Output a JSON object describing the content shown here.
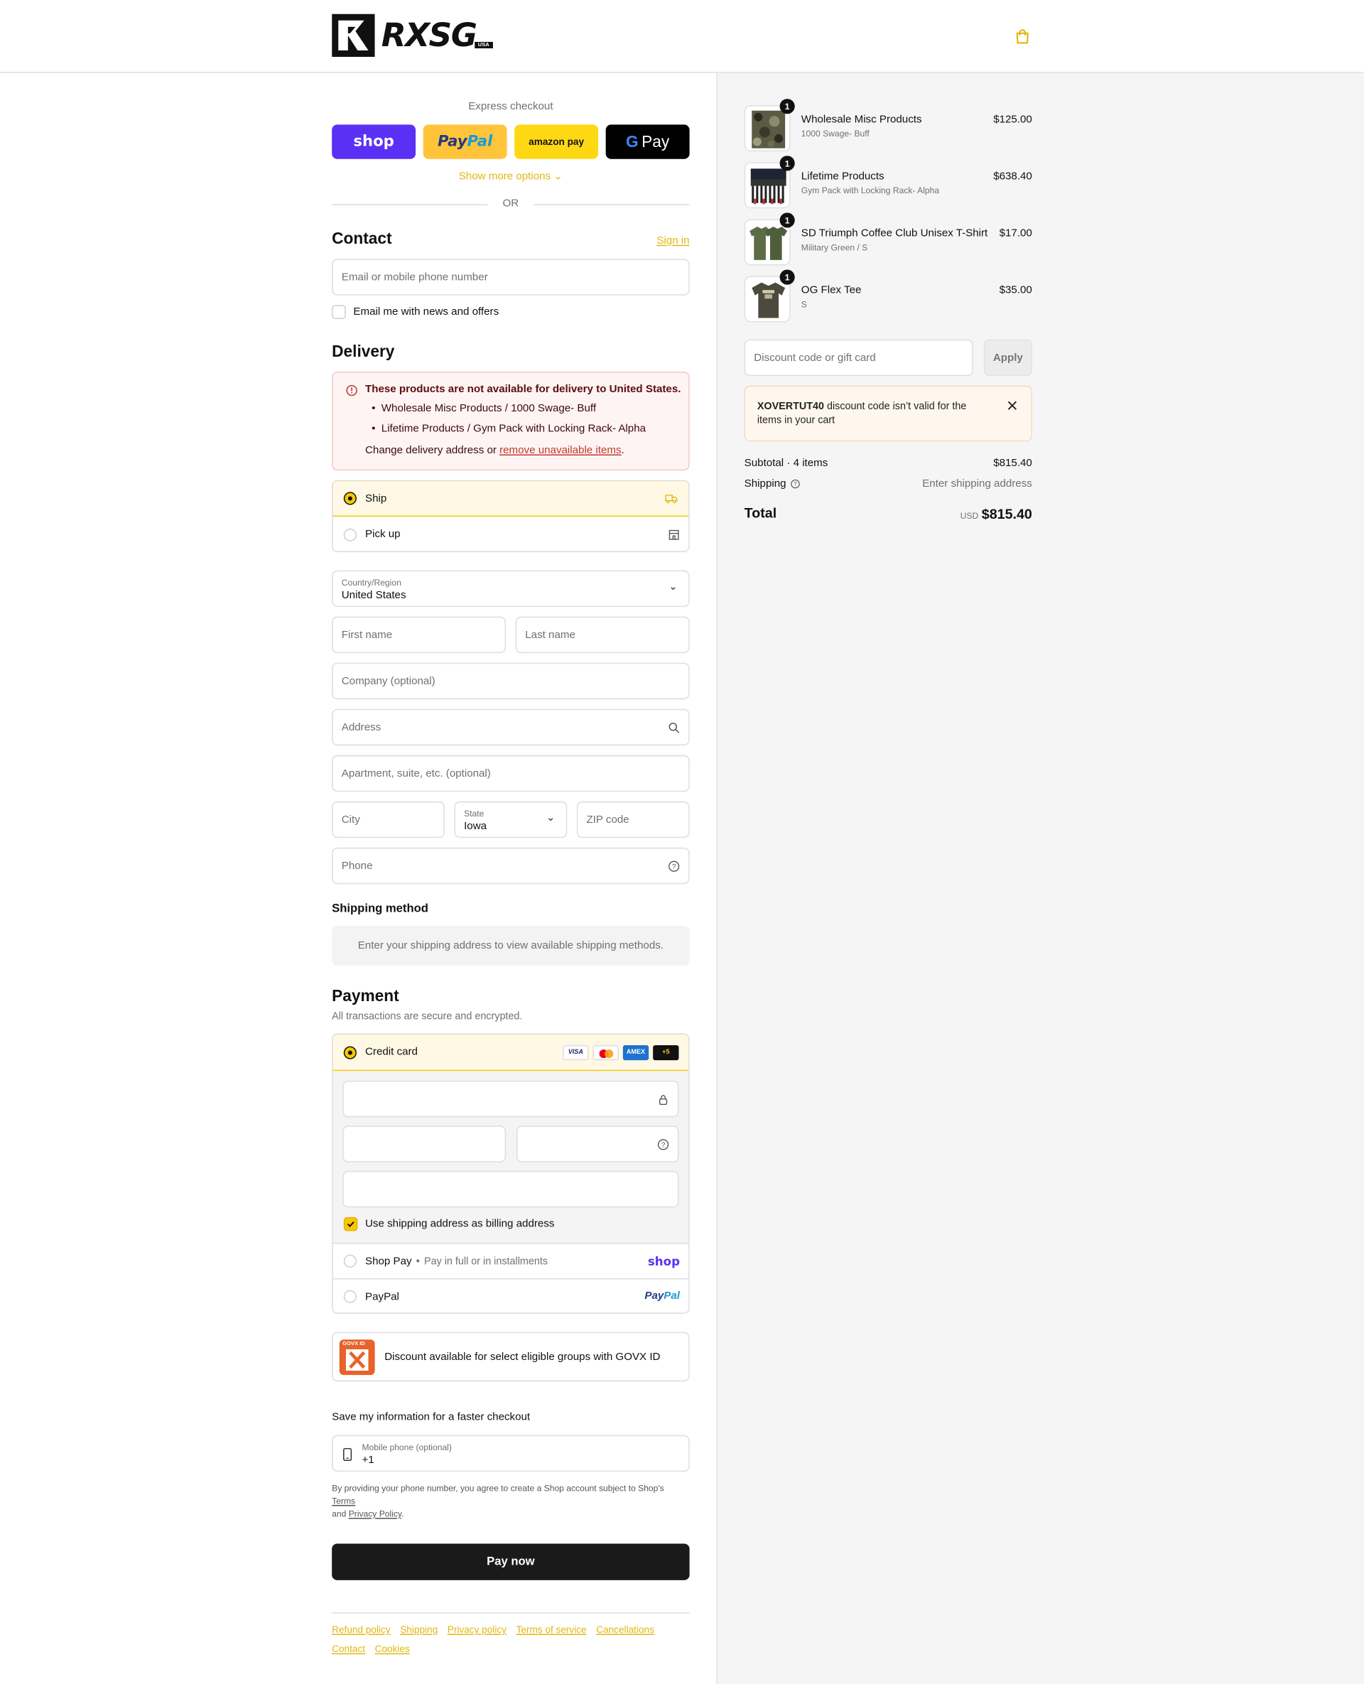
{
  "brand": {
    "name": "RXSG",
    "badge": "USA",
    "accent": "#f8c800",
    "link_color": "#e1b70e"
  },
  "express": {
    "label": "Express checkout",
    "shop_label": "shop",
    "paypal_label_1": "Pay",
    "paypal_label_2": "Pal",
    "amazon_label": "amazon pay",
    "gpay_label": "Pay",
    "show_more": "Show more options",
    "or_label": "OR"
  },
  "contact": {
    "title": "Contact",
    "sign_in": "Sign in",
    "email_placeholder": "Email or mobile phone number",
    "newsletter_label": "Email me with news and offers"
  },
  "delivery": {
    "title": "Delivery",
    "error_title": "These products are not available for delivery to United States.",
    "error_items": [
      "Wholesale Misc Products / 1000 Swage- Buff",
      "Lifetime Products / Gym Pack with Locking Rack- Alpha"
    ],
    "error_change_text": "Change delivery address or ",
    "error_remove_link": "remove unavailable items",
    "error_period": ".",
    "ship_label": "Ship",
    "pickup_label": "Pick up",
    "country_label": "Country/Region",
    "country_value": "United States",
    "first_name": "First name",
    "last_name": "Last name",
    "company": "Company (optional)",
    "address": "Address",
    "apartment": "Apartment, suite, etc. (optional)",
    "city": "City",
    "state_label": "State",
    "state_value": "Iowa",
    "zip": "ZIP code",
    "phone": "Phone"
  },
  "shipping_method": {
    "title": "Shipping method",
    "message": "Enter your shipping address to view available shipping methods."
  },
  "payment": {
    "title": "Payment",
    "subtitle": "All transactions are secure and encrypted.",
    "credit_card_label": "Credit card",
    "card_badges": [
      "VISA",
      "",
      "AMEX",
      "+5"
    ],
    "billing_same_label": "Use shipping address as billing address",
    "shop_pay_label": "Shop Pay",
    "shop_pay_sub": "Pay in full or in installments",
    "shop_pay_logo": "shop",
    "paypal_label": "PayPal",
    "paypal_logo_1": "Pay",
    "paypal_logo_2": "Pal"
  },
  "govx": {
    "logo_text": "GOVX ID",
    "text": "Discount available for select eligible groups with GOVX ID"
  },
  "save_info": {
    "title": "Save my information for a faster checkout",
    "mobile_label": "Mobile phone (optional)",
    "mobile_value": "+1",
    "legal_1": "By providing your phone number, you agree to create a Shop account subject to Shop's ",
    "legal_terms": "Terms",
    "legal_2": "and ",
    "legal_privacy": "Privacy Policy",
    "legal_3": "."
  },
  "pay_now": "Pay now",
  "footer_links": [
    "Refund policy",
    "Shipping",
    "Privacy policy",
    "Terms of service",
    "Cancellations",
    "Contact",
    "Cookies"
  ],
  "cart": {
    "items": [
      {
        "qty": "1",
        "name": "Wholesale Misc Products",
        "variant": "1000 Swage- Buff",
        "price": "$125.00"
      },
      {
        "qty": "1",
        "name": "Lifetime Products",
        "variant": "Gym Pack with Locking Rack- Alpha",
        "price": "$638.40"
      },
      {
        "qty": "1",
        "name": "SD Triumph Coffee Club Unisex T-Shirt",
        "variant": "Military Green / S",
        "price": "$17.00"
      },
      {
        "qty": "1",
        "name": "OG Flex Tee",
        "variant": "S",
        "price": "$35.00"
      }
    ],
    "discount_placeholder": "Discount code or gift card",
    "apply_label": "Apply",
    "discount_error_code": "XOVERTUT40",
    "discount_error_text": " discount code isn’t valid for the items in your cart",
    "subtotal_label": "Subtotal · 4 items",
    "subtotal_value": "$815.40",
    "shipping_label": "Shipping",
    "shipping_value": "Enter shipping address",
    "total_label": "Total",
    "total_currency": "USD",
    "total_value": "$815.40"
  }
}
